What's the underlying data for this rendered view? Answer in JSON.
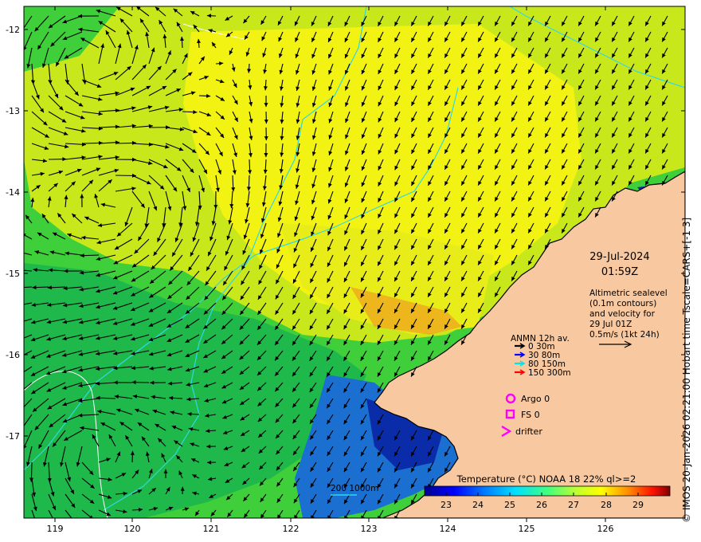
{
  "map": {
    "date": "29-Jul-2024",
    "time": "01:59Z",
    "altimetry_note": [
      "Altimetric sealevel",
      "(0.1m contours)",
      "and velocity for",
      "29 Jul 01Z",
      "0.5m/s (1kt 24h)"
    ],
    "lon_ticks": [
      "119",
      "120",
      "121",
      "122",
      "123",
      "124",
      "125",
      "126"
    ],
    "lat_ticks": [
      "-12",
      "-13",
      "-14",
      "-15",
      "-16",
      "-17"
    ],
    "anmn": {
      "title": "ANMN 12h av.",
      "items": [
        {
          "label": "0 30m",
          "color": "#000000"
        },
        {
          "label": "30 80m",
          "color": "#0000ff"
        },
        {
          "label": "80 150m",
          "color": "#00e5e5"
        },
        {
          "label": "150 300m",
          "color": "#ff0000"
        }
      ]
    },
    "markers": {
      "argo": "Argo 0",
      "fs": "FS 0",
      "drifter": "drifter",
      "marker_color": "#ff00ff"
    },
    "bathymetry_legend": "200  1000m",
    "colorbar": {
      "title": "Temperature (°C) NOAA 18 22% ql>=2",
      "ticks": [
        "23",
        "24",
        "25",
        "26",
        "27",
        "28",
        "29"
      ]
    },
    "credit": "© IMOS 20-Jan-2026 02:21:00 Hobart time Tscale=CARS+[-1 3]",
    "colors": {
      "land": "#f8c9a0",
      "coast": "#000000",
      "isobath": "#2fd8e8",
      "sealevel_contour": "#ffffff"
    }
  }
}
